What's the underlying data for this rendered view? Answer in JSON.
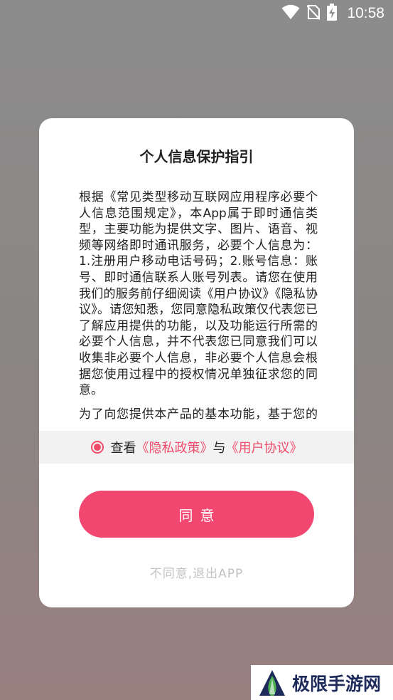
{
  "status_bar": {
    "time": "10:58",
    "icons": [
      "wifi-icon",
      "no-sim-icon",
      "battery-charging-icon"
    ]
  },
  "dialog": {
    "title": "个人信息保护指引",
    "paragraphs": [
      "根据《常见类型移动互联网应用程序必要个人信息范围规定》，本App属于即时通信类型，主要功能为提供文字、图片、语音、视频等网络即时通讯服务，必要个人信息为：1.注册用户移动电话号码；2.账号信息：账号、即时通信联系人账号列表。请您在使用我们的服务前仔细阅读《用户协议》《隐私协议》。请您知悉，您同意隐私政策仅代表您已了解应用提供的功能，以及功能运行所需的必要个人信息，并不代表您已同意我们可以收集非必要个人信息，非必要个人信息会根据您使用过程中的授权情况单独征求您的同意。",
      "为了向您提供本产品的基本功能，基于您的明示授权，我们会收集、使用必要的信息。"
    ],
    "consent": {
      "prefix": "查看",
      "privacy_link": "《隐私政策》",
      "conjunction": "与",
      "agreement_link": "《用户协议》",
      "accent_color": "#ee4b6a"
    },
    "agree_label": "同意",
    "disagree_label": "不同意,退出APP"
  },
  "watermark": {
    "text": "极限手游网"
  }
}
